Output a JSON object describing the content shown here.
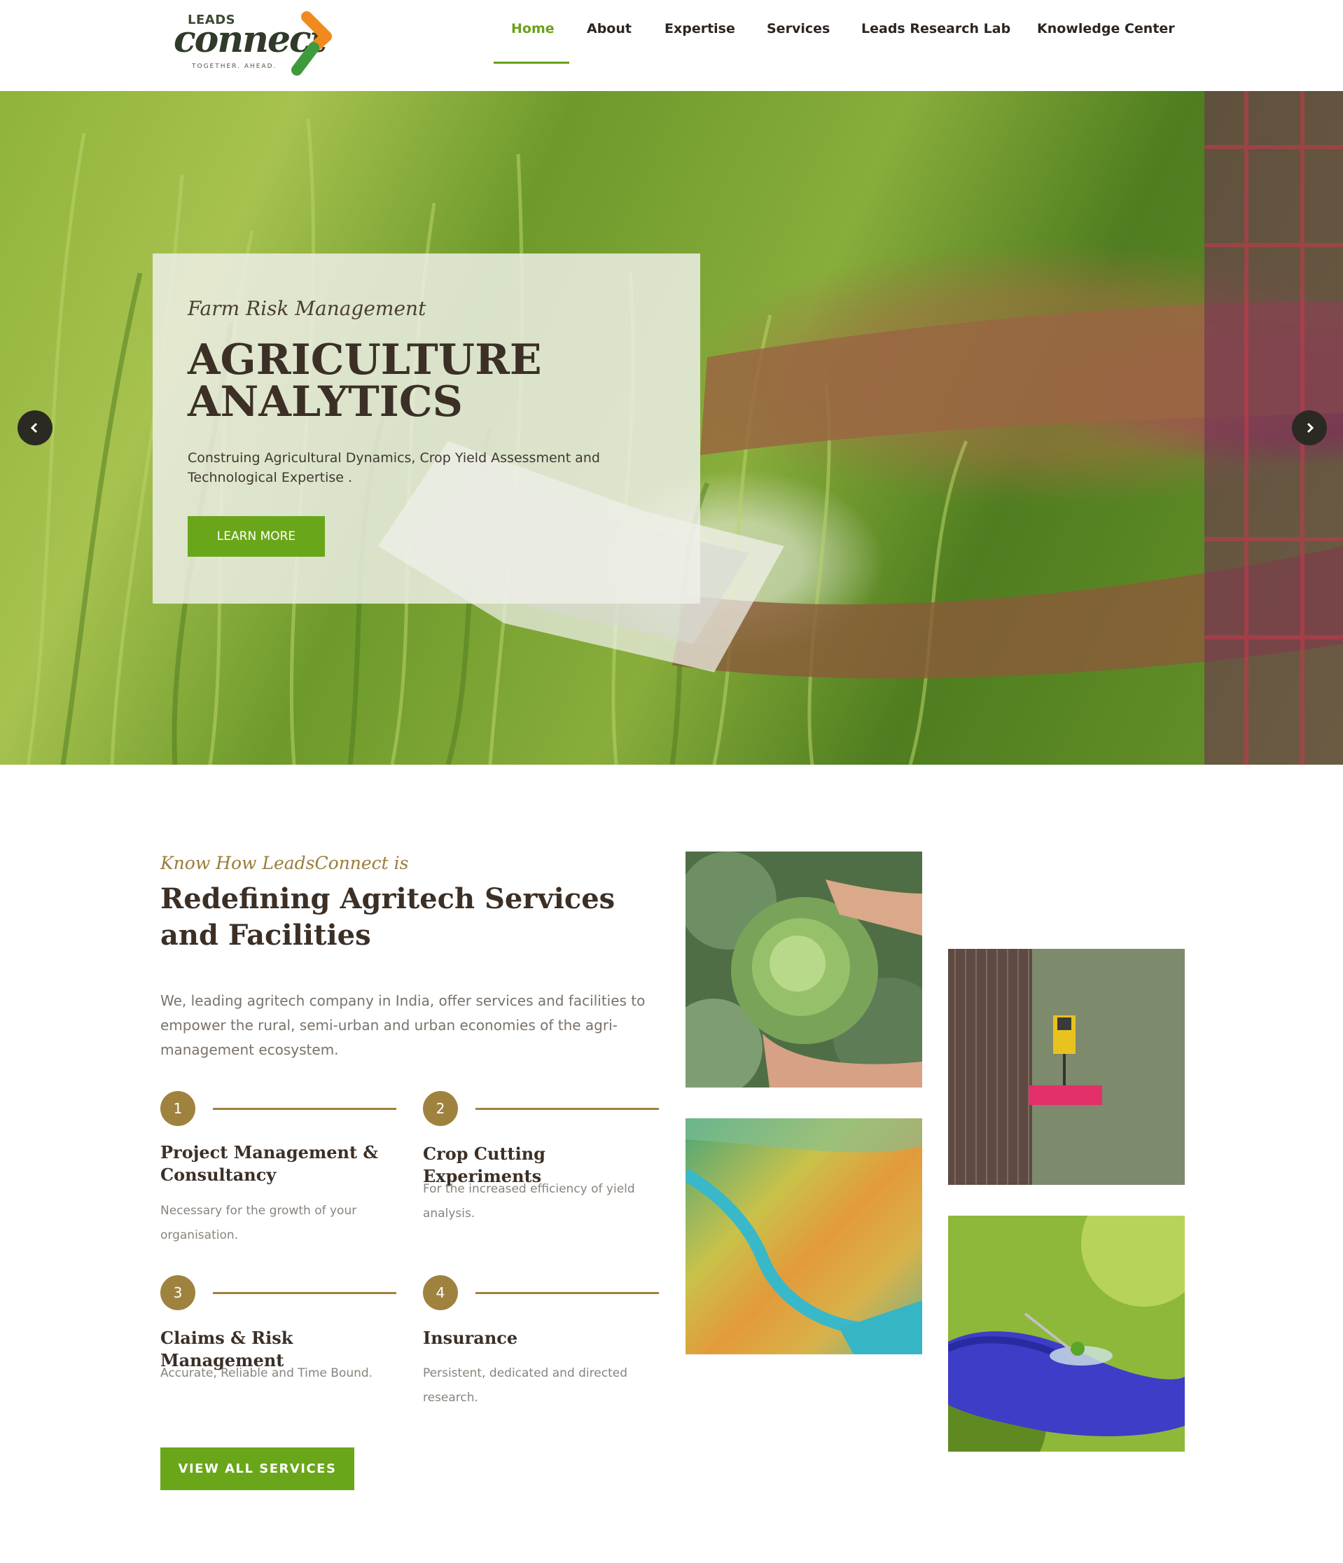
{
  "header": {
    "logo": {
      "top_text": "LEADS",
      "main_text": "connect",
      "tagline": "TOGETHER. AHEAD."
    },
    "nav": [
      {
        "label": "Home",
        "active": true
      },
      {
        "label": "About",
        "active": false
      },
      {
        "label": "Expertise",
        "active": false
      },
      {
        "label": "Services",
        "active": false
      },
      {
        "label": "Leads Research Lab",
        "active": false
      },
      {
        "label": "Knowledge Center",
        "active": false
      }
    ]
  },
  "hero": {
    "eyebrow": "Farm Risk Management",
    "title_line1": "AGRICULTURE",
    "title_line2": "ANALYTICS",
    "description": "Construing Agricultural Dynamics, Crop Yield Assessment and Technological Expertise .",
    "button_label": "LEARN MORE",
    "prev_icon": "chevron-left-icon",
    "next_icon": "chevron-right-icon"
  },
  "about": {
    "eyebrow": "Know How LeadsConnect is",
    "title": "Redefining Agritech Services and Facilities",
    "description": "We, leading agritech company in India, offer services and facilities to empower the rural, semi-urban and urban economies of the agri-management ecosystem.",
    "steps": [
      {
        "number": "1",
        "title": "Project Management & Consultancy",
        "description": "Necessary for the growth of your organisation."
      },
      {
        "number": "2",
        "title": "Crop Cutting Experiments",
        "description": "For the increased efficiency of yield analysis."
      },
      {
        "number": "3",
        "title": "Claims & Risk Management",
        "description": "Accurate, Reliable and Time Bound."
      },
      {
        "number": "4",
        "title": "Insurance",
        "description": "Persistent, dedicated and directed research."
      }
    ],
    "button_label": "VIEW ALL SERVICES"
  },
  "colors": {
    "accent_green": "#6aa61a",
    "accent_gold": "#a0823f",
    "heading_brown": "#3b2f26"
  }
}
